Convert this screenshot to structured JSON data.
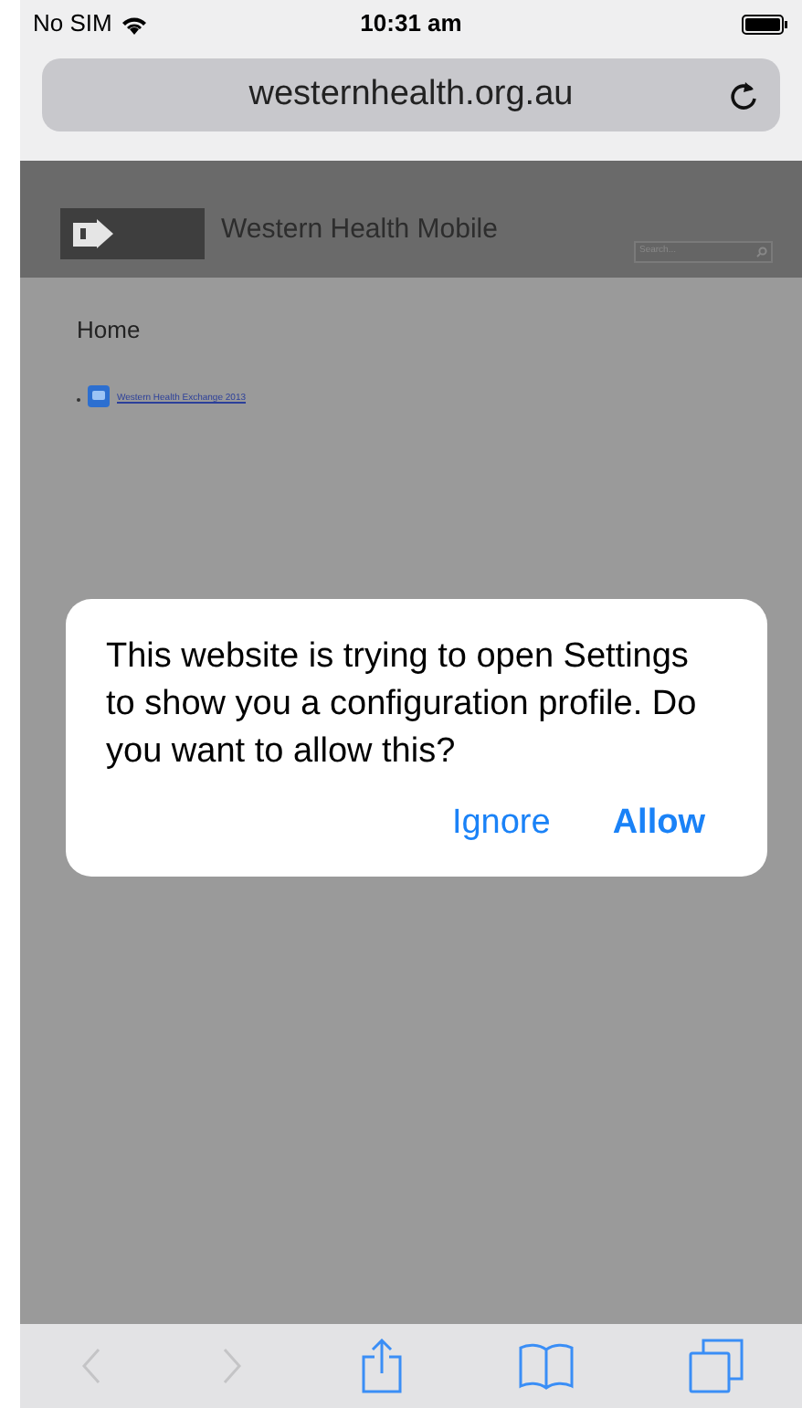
{
  "status_bar": {
    "carrier": "No SIM",
    "time": "10:31 am"
  },
  "address_bar": {
    "url": "westernhealth.org.au"
  },
  "site": {
    "title": "Western Health Mobile",
    "search": {
      "placeholder": "Search..."
    },
    "heading": "Home",
    "links": [
      {
        "label": "Western Health Exchange 2013"
      }
    ]
  },
  "alert": {
    "message": "This website is trying to open Settings to show you a configuration profile. Do you want to allow this?",
    "buttons": [
      {
        "label": "Ignore",
        "kind": "normal"
      },
      {
        "label": "Allow",
        "kind": "bold"
      }
    ]
  },
  "toolbar": {
    "back": {
      "disabled": true
    },
    "forward": {
      "disabled": true
    }
  }
}
